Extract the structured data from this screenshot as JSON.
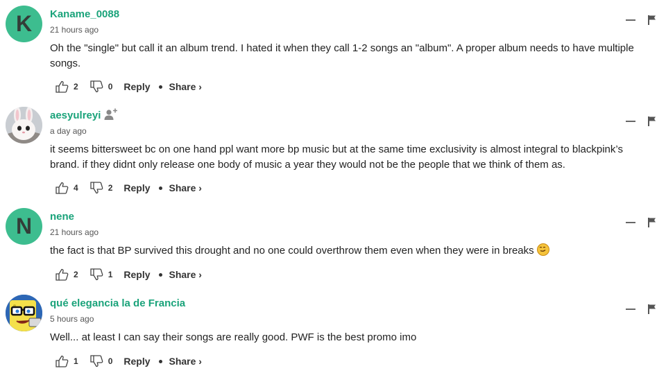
{
  "comments": [
    {
      "avatar_letter": "K",
      "username": "Kaname_0088",
      "time": "21 hours ago",
      "text": "Oh the \"single\" but call it an album trend. I hated it when they call 1-2 songs an \"album\". A proper album needs to have multiple songs.",
      "likes": "2",
      "dislikes": "0",
      "reply_label": "Reply",
      "share_label": "Share ›"
    },
    {
      "avatar_image": "bunny-plush-avatar",
      "username": "aesyulreyi",
      "time": "a day ago",
      "text": "it seems bittersweet bc on one hand ppl want more bp music but at the same time exclusivity is almost integral to blackpink’s brand. if they didnt only release one body of music a year they would not be the people that we think of them as.",
      "likes": "4",
      "dislikes": "2",
      "reply_label": "Reply",
      "share_label": "Share ›"
    },
    {
      "avatar_letter": "N",
      "username": "nene",
      "time": "21 hours ago",
      "text": "the fact is that BP survived this drought and no one could overthrow them even when they were in breaks",
      "emoji": "smirk-emoji",
      "likes": "2",
      "dislikes": "1",
      "reply_label": "Reply",
      "share_label": "Share ›"
    },
    {
      "avatar_image": "spongebob-glasses-avatar",
      "username": "qué elegancia la de Francia",
      "time": "5 hours ago",
      "text": "Well... at least I can say their songs are really good. PWF is the best promo imo",
      "likes": "1",
      "dislikes": "0",
      "reply_label": "Reply",
      "share_label": "Share ›"
    }
  ],
  "colors": {
    "username": "#1aa37a",
    "avatar_bg": "#3dbd8f",
    "text": "#222222"
  },
  "icons": [
    "thumbs-up-icon",
    "thumbs-down-icon",
    "collapse-icon",
    "flag-icon",
    "follow-user-icon"
  ]
}
